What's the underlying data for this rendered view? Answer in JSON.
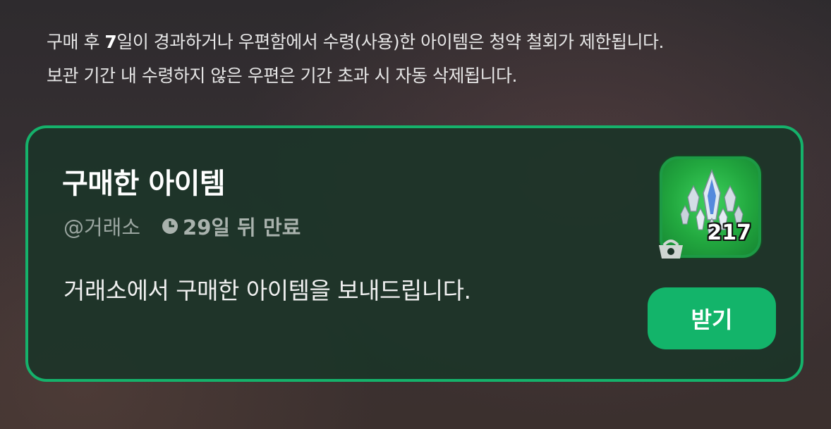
{
  "notice": {
    "line1_pre": "구매 후 ",
    "line1_highlight": "7",
    "line1_post": "일이 경과하거나 우편함에서 수령(사용)한 아이템은 청약 철회가 제한됩니다.",
    "line2": "보관 기간 내 수령하지 않은 우편은 기간 초과 시 자동 삭제됩니다."
  },
  "mail": {
    "title": "구매한 아이템",
    "sender": "@거래소",
    "expiry": "29일 뒤 만료",
    "message": "거래소에서 구매한 아이템을 보내드립니다.",
    "item": {
      "icon": "crystal-cluster-icon",
      "count": "217",
      "badge_icon": "basket-icon"
    },
    "receive_label": "받기"
  },
  "colors": {
    "accent": "#15b26b",
    "button": "#13b46a",
    "card_bg": "#1c3428",
    "item_bg": "#2fbd4d"
  }
}
